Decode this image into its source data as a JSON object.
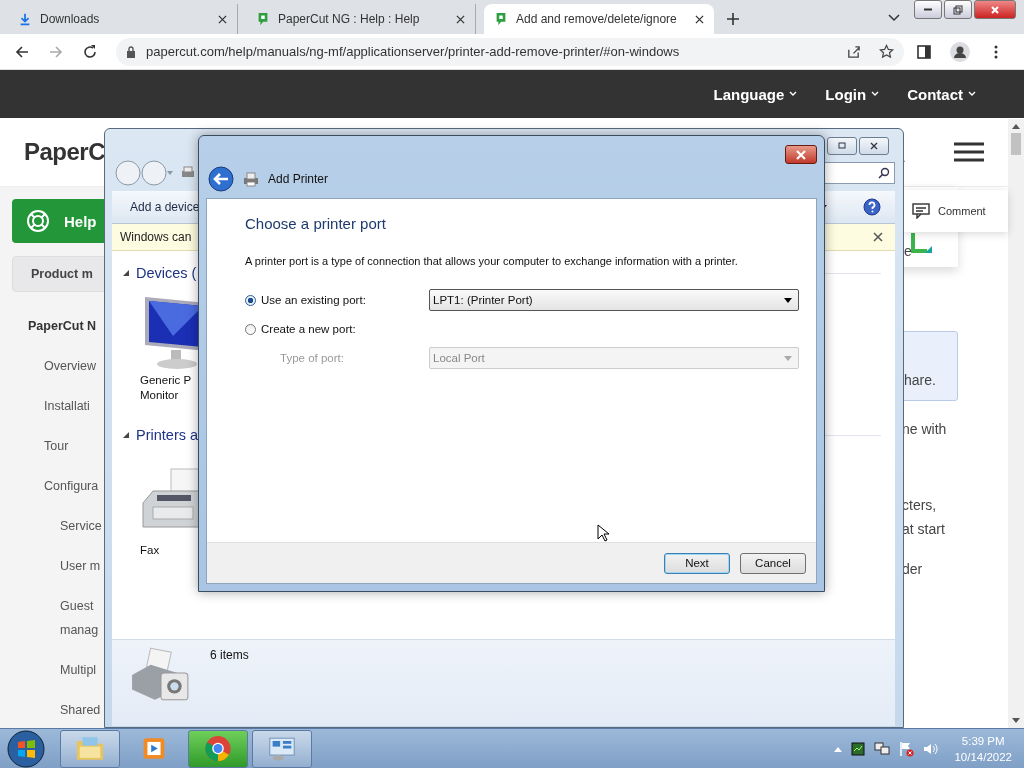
{
  "browser": {
    "tabs": [
      {
        "title": "Downloads",
        "selected": false
      },
      {
        "title": "PaperCut NG : Help : Help",
        "selected": false
      },
      {
        "title": "Add and remove/delete/ignore",
        "selected": true
      }
    ],
    "address": "papercut.com/help/manuals/ng-mf/applicationserver/printer-add-remove-printer/#on-windows"
  },
  "site": {
    "nav": [
      "Language",
      "Login",
      "Contact"
    ],
    "logo": "PaperC",
    "help_button": "Help",
    "product_button": "Product m",
    "sidebar": [
      {
        "label": "PaperCut N",
        "children": [
          {
            "label": "Overview"
          },
          {
            "label": "Installati"
          },
          {
            "label": "Tour"
          },
          {
            "label": "Configura",
            "children": [
              {
                "label": "Service"
              },
              {
                "label": "User m"
              },
              {
                "label": "Guest\nmanag"
              },
              {
                "label": "Multipl"
              },
              {
                "label": "Shared"
              }
            ]
          }
        ]
      }
    ],
    "comment_button": "Comment",
    "card_text": "e",
    "note_text": "hare.",
    "paragraphs": [
      [
        "ne with"
      ],
      [
        "cters,",
        "at start"
      ],
      [
        "der"
      ]
    ]
  },
  "explorer": {
    "command": "Add a device",
    "notice": "Windows can",
    "groups": [
      {
        "title": "Devices (",
        "expanded": true,
        "items": [
          {
            "label": "Generic P\nMonitor",
            "kind": "monitor"
          }
        ]
      },
      {
        "title": "Printers a",
        "expanded": true,
        "items": [
          {
            "label": "Fax",
            "kind": "fax"
          }
        ]
      }
    ],
    "status": "6 items"
  },
  "dialog": {
    "title": "Add Printer",
    "heading": "Choose a printer port",
    "description": "A printer port is a type of connection that allows your computer to exchange information with a printer.",
    "options": [
      {
        "label": "Use an existing port:",
        "selected": true,
        "value": "LPT1: (Printer Port)"
      },
      {
        "label": "Create a new port:",
        "selected": false,
        "sub_label": "Type of port:",
        "value": "Local Port"
      }
    ],
    "buttons": [
      {
        "label": "Next",
        "default": true
      },
      {
        "label": "Cancel",
        "default": false
      }
    ]
  },
  "taskbar": {
    "apps": [
      {
        "kind": "explorer",
        "running": true,
        "hovered": false
      },
      {
        "kind": "media",
        "running": false,
        "hovered": false
      },
      {
        "kind": "chrome",
        "running": true,
        "hovered": true
      },
      {
        "kind": "control-panel",
        "running": true,
        "hovered": false
      }
    ],
    "time": "5:39 PM",
    "date": "10/14/2022"
  }
}
